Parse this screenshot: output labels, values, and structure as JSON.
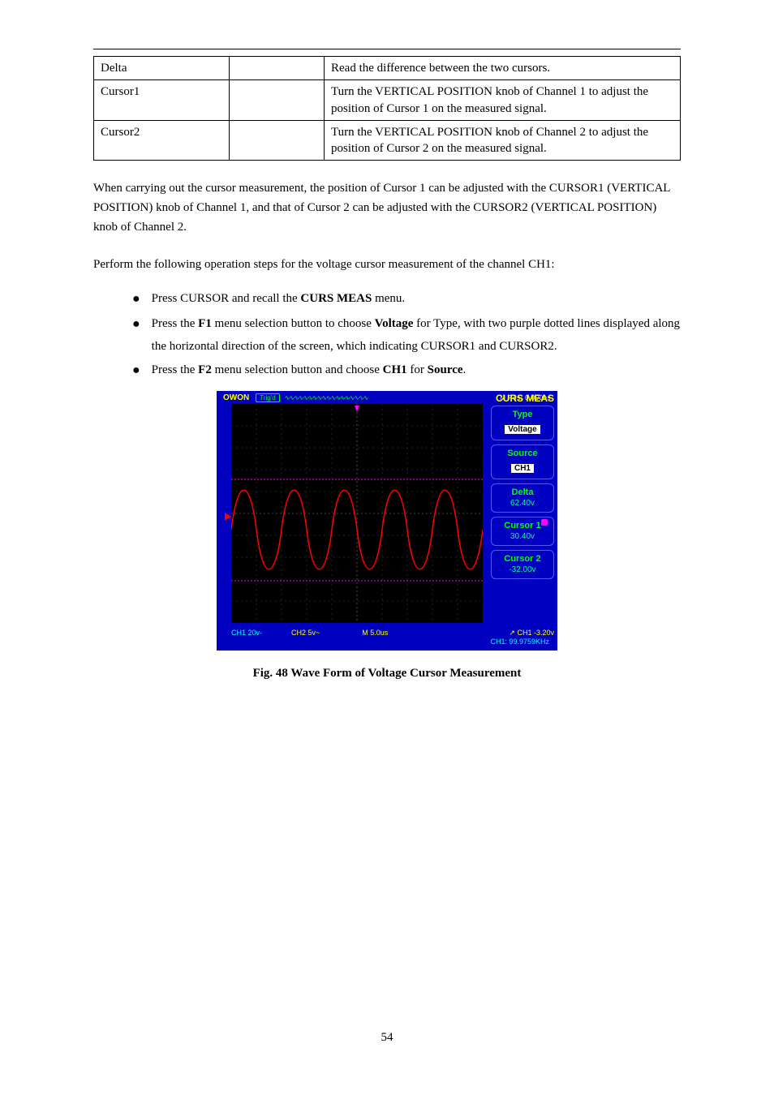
{
  "table": {
    "r1": {
      "c1": "Delta",
      "c2": "",
      "c3": "Read the difference between the two cursors."
    },
    "r2": {
      "c1": "Cursor1",
      "c2": "",
      "c3": "Turn the VERTICAL POSITION knob of Channel 1 to adjust the position of Cursor 1 on the measured signal."
    },
    "r3": {
      "c1": "Cursor2",
      "c2": "",
      "c3": "Turn the VERTICAL POSITION knob of Channel 2 to adjust the position of Cursor 2 on the measured signal."
    }
  },
  "para": "When carrying out the cursor measurement, the position of Cursor 1 can be adjusted with the CURSOR1 (VERTICAL POSITION) knob of Channel 1, and that of Cursor 2 can be adjusted with the CURSOR2 (VERTICAL POSITION) knob of Channel 2.",
  "bullets": {
    "b1": {
      "pre": "Perform the following operation steps for the voltage cursor measurement of the channel CH1:"
    },
    "b2": {
      "pre": "Press CURSOR and recall the ",
      "bold": "CURS MEAS",
      "post": " menu."
    },
    "b3": {
      "pre": "Press the ",
      "bold1": "F1",
      "mid": " menu selection button to choose ",
      "bold2": "Voltage",
      "post": " for Type, with two purple dotted lines displayed along the horizontal direction of the screen, which indicating CURSOR1 and CURSOR2."
    },
    "b4": {
      "pre": "Press the ",
      "bold1": "F2",
      "mid": " menu selection button and choose ",
      "bold2": "CH1",
      "post": " for ",
      "bold3": "Source",
      "end": "."
    }
  },
  "scope": {
    "brand": "OWON",
    "trig": "Trig'd",
    "mpos": "M Pos: 0.000ns",
    "curs_title": "CURS MEAS",
    "menu": {
      "type_label": "Type",
      "type_value": "Voltage",
      "source_label": "Source",
      "source_value": "CH1",
      "delta_label": "Delta",
      "delta_value": "62.40v",
      "c1_label": "Cursor 1",
      "c1_value": "30.40v",
      "c2_label": "Cursor 2",
      "c2_value": "-32.00v"
    },
    "bottom": {
      "ch1": "CH1 20v-",
      "ch2": "CH2 5v~",
      "m": "M 5.0us",
      "trg": "CH1 -3.20v",
      "freq": "CH1: 99.9759KHz"
    }
  },
  "caption": "Fig. 48 Wave Form of Voltage Cursor Measurement",
  "pagenum": "54"
}
